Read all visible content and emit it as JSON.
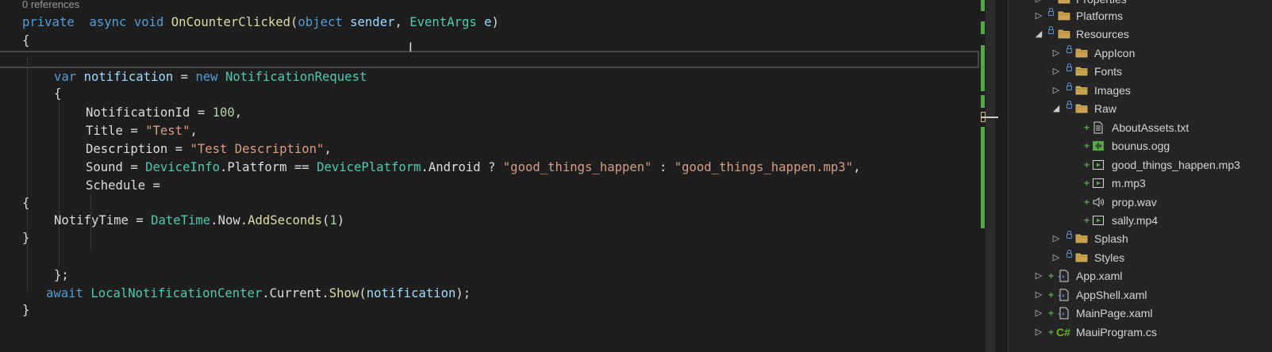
{
  "editor": {
    "codelens": "0 references",
    "lines": {
      "l1": [
        "private",
        "async",
        "void",
        "OnCounterClicked",
        "(",
        "object",
        "sender",
        ", ",
        "EventArgs",
        "e",
        ")"
      ],
      "l2": "{",
      "l4": [
        "var",
        "notification",
        " = ",
        "new",
        "NotificationRequest"
      ],
      "l5": "{",
      "l6": [
        "NotificationId",
        " = ",
        "100",
        ","
      ],
      "l7": [
        "Title",
        " = ",
        "\"Test\"",
        ","
      ],
      "l8": [
        "Description",
        " = ",
        "\"Test Description\"",
        ","
      ],
      "l9": [
        "Sound",
        " = ",
        "DeviceInfo",
        ".",
        "Platform",
        " == ",
        "DevicePlatform",
        ".",
        "Android",
        " ? ",
        "\"good_things_happen\"",
        " : ",
        "\"good_things_happen.mp3\"",
        ","
      ],
      "l10": [
        "Schedule",
        " ="
      ],
      "l11": "{",
      "l12": [
        "NotifyTime",
        " = ",
        "DateTime",
        ".",
        "Now",
        ".",
        "AddSeconds",
        "(",
        "1",
        ")"
      ],
      "l13": "}",
      "l15": "};",
      "l16": [
        "await",
        "LocalNotificationCenter",
        ".",
        "Current",
        ".",
        "Show",
        "(",
        "notification",
        ");"
      ],
      "l17": "}"
    }
  },
  "explorer": {
    "items": [
      {
        "label": "Properties",
        "icon": "folder-icon",
        "expanded": false
      },
      {
        "label": "Platforms",
        "icon": "folder-icon",
        "expanded": false
      },
      {
        "label": "Resources",
        "icon": "folder-icon",
        "expanded": true
      },
      {
        "label": "AppIcon",
        "icon": "folder-icon",
        "expanded": false
      },
      {
        "label": "Fonts",
        "icon": "folder-icon",
        "expanded": false
      },
      {
        "label": "Images",
        "icon": "folder-icon",
        "expanded": false
      },
      {
        "label": "Raw",
        "icon": "folder-icon",
        "expanded": true
      },
      {
        "label": "AboutAssets.txt",
        "icon": "text-file-icon"
      },
      {
        "label": "bounus.ogg",
        "icon": "audio-file-icon"
      },
      {
        "label": "good_things_happen.mp3",
        "icon": "media-file-icon"
      },
      {
        "label": "m.mp3",
        "icon": "media-file-icon"
      },
      {
        "label": "prop.wav",
        "icon": "speaker-file-icon"
      },
      {
        "label": "sally.mp4",
        "icon": "media-file-icon"
      },
      {
        "label": "Splash",
        "icon": "folder-icon",
        "expanded": false
      },
      {
        "label": "Styles",
        "icon": "folder-icon",
        "expanded": false
      },
      {
        "label": "App.xaml",
        "icon": "xaml-file-icon",
        "expanded": false
      },
      {
        "label": "AppShell.xaml",
        "icon": "xaml-file-icon",
        "expanded": false
      },
      {
        "label": "MainPage.xaml",
        "icon": "xaml-file-icon",
        "expanded": false
      },
      {
        "label": "MauiProgram.cs",
        "icon": "csharp-file-icon",
        "expanded": false
      }
    ]
  },
  "colors": {
    "keyword": "#569cd6",
    "type": "#4ec9b0",
    "method": "#dcdcaa",
    "identifier": "#9cdcfe",
    "string": "#d69d85",
    "number": "#b5cea8",
    "change_marker": "#57a64a"
  }
}
